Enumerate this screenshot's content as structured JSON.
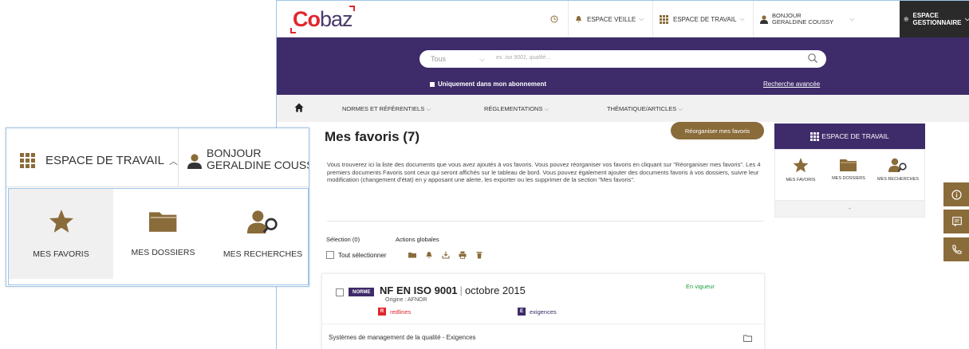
{
  "app": {
    "logo_text_co": "Co",
    "logo_text_baz": "baz"
  },
  "topbar": {
    "history_icon": "clock-icon",
    "veille_label": "ESPACE VEILLE",
    "travail_label": "ESPACE DE TRAVAIL",
    "user_line1": "BONJOUR",
    "user_line2": "GERALDINE COUSSY",
    "gestionnaire_label": "ESPACE GESTIONNAIRE"
  },
  "search": {
    "scope_value": "Tous",
    "placeholder": "ex. iso 9001, qualité...",
    "only_subscription_label": "Uniquement dans mon abonnement",
    "advanced_label": "Recherche avancée"
  },
  "menu": {
    "items": [
      "NORMES ET RÉFÉRENTIELS",
      "RÉGLEMENTATIONS",
      "THÉMATIQUE/ARTICLES"
    ]
  },
  "page": {
    "title": "Mes favoris (7)",
    "reorganize_label": "Réorganiser mes favoris",
    "intro": "Vous trouverez ici la liste des documents que vous avez ajoutés à vos favoris. Vous pouvez réorganiser vos favoris en cliquant sur \"Réorganiser mes favoris\". Les 4 premiers documents Favoris sont ceux qui seront affichés sur le tableau de bord. Vous pouvez également ajouter des documents favoris à vos dossiers, suivre leur modification (changement d'état) en y apposant une alerte, les exporter ou les supprimer de la section \"Mes favoris\".",
    "selection_label": "Sélection (0)",
    "global_actions_label": "Actions globales",
    "select_all_label": "Tout sélectionner"
  },
  "document": {
    "type_badge": "NORME",
    "reference": "NF EN ISO 9001",
    "separator": "|",
    "date": "octobre 2015",
    "origin": "Origine : AFNOR",
    "tag_r_letter": "R",
    "tag_r_label": "redlines",
    "tag_e_letter": "E",
    "tag_e_label": "exigences",
    "status": "En vigueur",
    "description": "Systèmes de management de la qualité - Exigences"
  },
  "sidebar": {
    "header": "ESPACE DE TRAVAIL",
    "items": [
      {
        "label": "MES FAVORIS",
        "icon": "star-icon"
      },
      {
        "label": "MES DOSSIERS",
        "icon": "folder-icon"
      },
      {
        "label": "MES RECHERCHES",
        "icon": "user-search-icon"
      }
    ],
    "footer": "-"
  },
  "zoom": {
    "espace_label": "ESPACE DE TRAVAIL",
    "user_line1": "BONJOUR",
    "user_line2": "GERALDINE COUSSY",
    "items": [
      {
        "label": "MES FAVORIS",
        "icon": "star-icon"
      },
      {
        "label": "MES DOSSIERS",
        "icon": "folder-icon"
      },
      {
        "label": "MES RECHERCHES",
        "icon": "user-search-icon"
      }
    ]
  },
  "colors": {
    "brand_purple": "#3e2b69",
    "brand_gold": "#8a6b3a",
    "brand_red": "#e1262d",
    "status_green": "#1f9d3a"
  }
}
